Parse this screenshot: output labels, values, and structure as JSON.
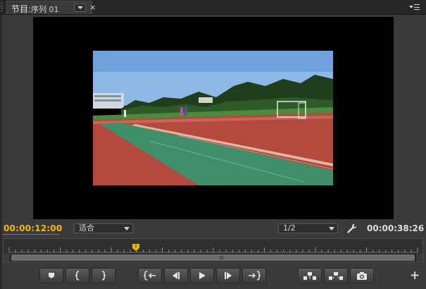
{
  "tab": {
    "label": "节目:",
    "sequence": "序列 01",
    "close": "×"
  },
  "panel": {
    "menu_icon": "panel-menu-icon"
  },
  "viewer": {
    "frame": "outdoor running track with athletes, green field and trees under blue sky",
    "colors": {
      "sky": "#8fb8e6",
      "track": "#b5493e",
      "turf": "#3f8f6a",
      "field": "#4c8a3e",
      "trees": "#1f3f1c"
    }
  },
  "controls": {
    "timecode_current": "00:00:12:00",
    "fit_select": "适合",
    "resolution_select": "1/2",
    "timecode_duration": "00:00:38:26",
    "playhead_fraction": 0.31
  },
  "transport": {
    "buttons": [
      {
        "name": "add-marker-button",
        "icon": "marker-icon"
      },
      {
        "name": "mark-in-button",
        "icon": "mark-in-icon"
      },
      {
        "name": "mark-out-button",
        "icon": "mark-out-icon"
      },
      {
        "name": "go-to-in-button",
        "icon": "go-to-in-icon"
      },
      {
        "name": "step-back-button",
        "icon": "step-back-icon"
      },
      {
        "name": "play-button",
        "icon": "play-icon"
      },
      {
        "name": "step-forward-button",
        "icon": "step-forward-icon"
      },
      {
        "name": "go-to-out-button",
        "icon": "go-to-out-icon"
      },
      {
        "name": "lift-button",
        "icon": "lift-icon"
      },
      {
        "name": "extract-button",
        "icon": "extract-icon"
      },
      {
        "name": "export-frame-button",
        "icon": "camera-icon"
      }
    ],
    "add": "+"
  }
}
